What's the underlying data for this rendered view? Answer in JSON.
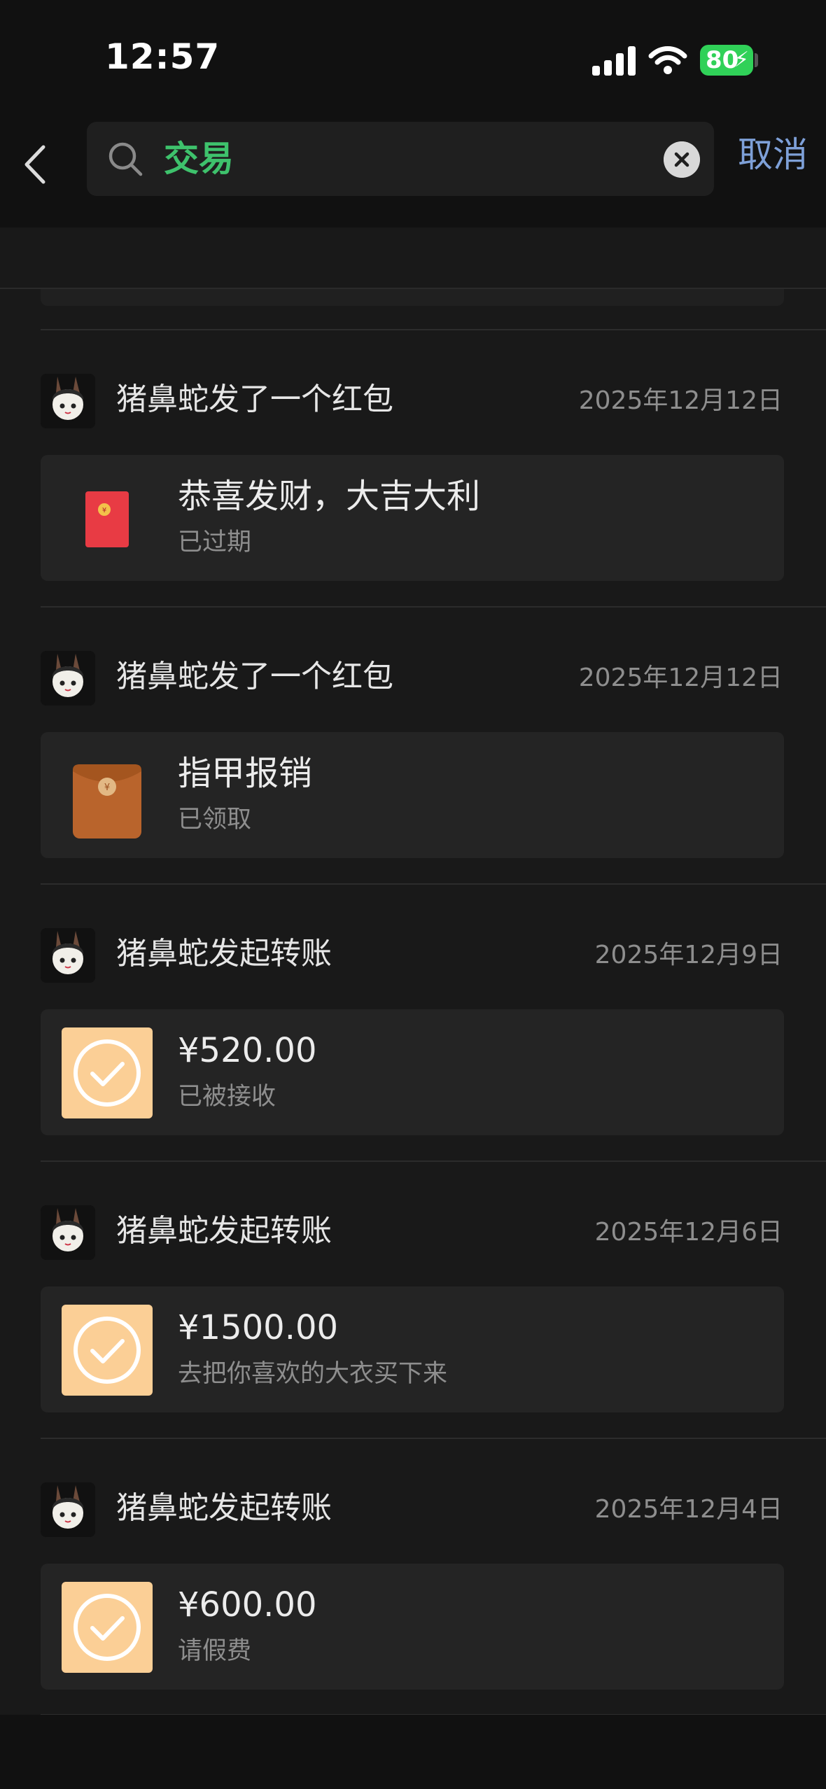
{
  "status_bar": {
    "time": "12:57",
    "battery": "80"
  },
  "search": {
    "query": "交易",
    "cancel_label": "取消"
  },
  "results": [
    {
      "title": "猪鼻蛇发了一个红包",
      "date": "2025年12月12日",
      "kind": "red-packet",
      "main": "恭喜发财，大吉大利",
      "sub": "已过期"
    },
    {
      "title": "猪鼻蛇发了一个红包",
      "date": "2025年12月12日",
      "kind": "red-packet-opened",
      "main": "指甲报销",
      "sub": "已领取"
    },
    {
      "title": "猪鼻蛇发起转账",
      "date": "2025年12月9日",
      "kind": "transfer",
      "main": "¥520.00",
      "sub": "已被接收"
    },
    {
      "title": "猪鼻蛇发起转账",
      "date": "2025年12月6日",
      "kind": "transfer",
      "main": "¥1500.00",
      "sub": "去把你喜欢的大衣买下来"
    },
    {
      "title": "猪鼻蛇发起转账",
      "date": "2025年12月4日",
      "kind": "transfer",
      "main": "¥600.00",
      "sub": "请假费"
    }
  ],
  "colors": {
    "accent_green": "#3ec26c",
    "cancel_blue": "#7ea0d8",
    "red_packet": "#e83b44",
    "opened_packet": "#b9642c",
    "transfer_icon": "#fbcf96"
  }
}
